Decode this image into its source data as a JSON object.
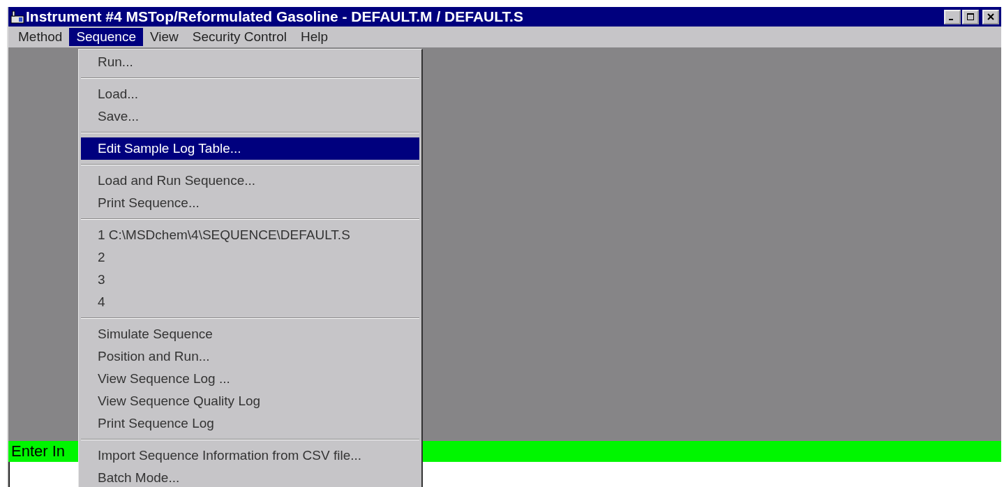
{
  "window": {
    "title": "Instrument #4 MSTop/Reformulated Gasoline - DEFAULT.M / DEFAULT.S"
  },
  "menubar": [
    {
      "label": "Method",
      "selected": false
    },
    {
      "label": "Sequence",
      "selected": true
    },
    {
      "label": "View",
      "selected": false
    },
    {
      "label": "Security Control",
      "selected": false
    },
    {
      "label": "Help",
      "selected": false
    }
  ],
  "menu": [
    {
      "kind": "item",
      "label": "Run...",
      "selected": false
    },
    {
      "kind": "separator"
    },
    {
      "kind": "item",
      "label": "Load...",
      "selected": false
    },
    {
      "kind": "item",
      "label": "Save...",
      "selected": false
    },
    {
      "kind": "separator"
    },
    {
      "kind": "item",
      "label": "Edit Sample Log Table...",
      "selected": true
    },
    {
      "kind": "separator"
    },
    {
      "kind": "item",
      "label": "Load and Run Sequence...",
      "selected": false
    },
    {
      "kind": "item",
      "label": "Print Sequence...",
      "selected": false
    },
    {
      "kind": "separator"
    },
    {
      "kind": "item",
      "label": "1 C:\\MSDchem\\4\\SEQUENCE\\DEFAULT.S",
      "selected": false
    },
    {
      "kind": "item",
      "label": "2",
      "selected": false
    },
    {
      "kind": "item",
      "label": "3",
      "selected": false
    },
    {
      "kind": "item",
      "label": "4",
      "selected": false
    },
    {
      "kind": "separator"
    },
    {
      "kind": "item",
      "label": "Simulate Sequence",
      "selected": false
    },
    {
      "kind": "item",
      "label": "Position and Run...",
      "selected": false
    },
    {
      "kind": "item",
      "label": "View Sequence Log ...",
      "selected": false
    },
    {
      "kind": "item",
      "label": "View Sequence Quality Log",
      "selected": false
    },
    {
      "kind": "item",
      "label": "Print Sequence Log",
      "selected": false
    },
    {
      "kind": "separator"
    },
    {
      "kind": "item",
      "label": "Import Sequence Information from CSV file...",
      "selected": false
    },
    {
      "kind": "item",
      "label": "Batch Mode...",
      "selected": false
    }
  ],
  "prompt_bar": {
    "text": "Enter In"
  }
}
